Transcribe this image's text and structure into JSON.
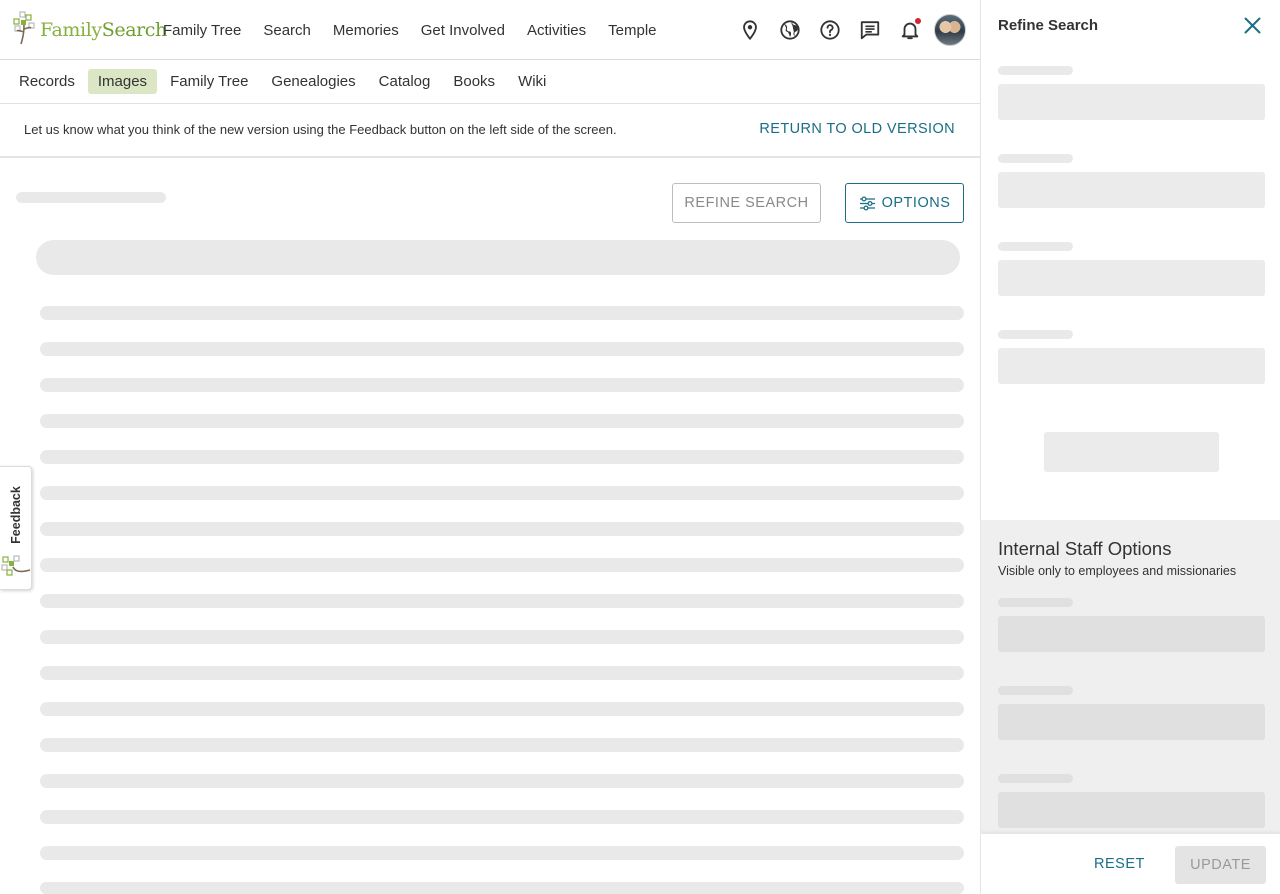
{
  "brand": {
    "name_part1": "Family",
    "name_part2": "Search",
    "colors": {
      "green": "#87b13f",
      "teal": "#1a6e85",
      "active_tab": "#dbe7c4",
      "notification_dot": "#d9232e"
    }
  },
  "top_nav": {
    "links": [
      {
        "label": "Family Tree"
      },
      {
        "label": "Search"
      },
      {
        "label": "Memories"
      },
      {
        "label": "Get Involved"
      },
      {
        "label": "Activities"
      },
      {
        "label": "Temple"
      }
    ],
    "icons": [
      "map-pin-icon",
      "globe-icon",
      "help-icon",
      "messages-icon",
      "bell-icon"
    ],
    "has_notification": true
  },
  "sub_nav": {
    "items": [
      {
        "label": "Records",
        "active": false
      },
      {
        "label": "Images",
        "active": true
      },
      {
        "label": "Family Tree",
        "active": false
      },
      {
        "label": "Genealogies",
        "active": false
      },
      {
        "label": "Catalog",
        "active": false
      },
      {
        "label": "Books",
        "active": false
      },
      {
        "label": "Wiki",
        "active": false
      }
    ]
  },
  "feedback_banner": {
    "message": "Let us know what you think of the new version using the Feedback button on the left side of the screen.",
    "return_link": "RETURN TO OLD VERSION"
  },
  "toolbar": {
    "refine_label": "REFINE SEARCH",
    "options_label": "OPTIONS"
  },
  "feedback_tab": {
    "label": "Feedback"
  },
  "refine_panel": {
    "title": "Refine Search",
    "staff_title": "Internal Staff Options",
    "staff_subtitle": "Visible only to employees and missionaries",
    "reset_label": "RESET",
    "update_label": "UPDATE"
  }
}
